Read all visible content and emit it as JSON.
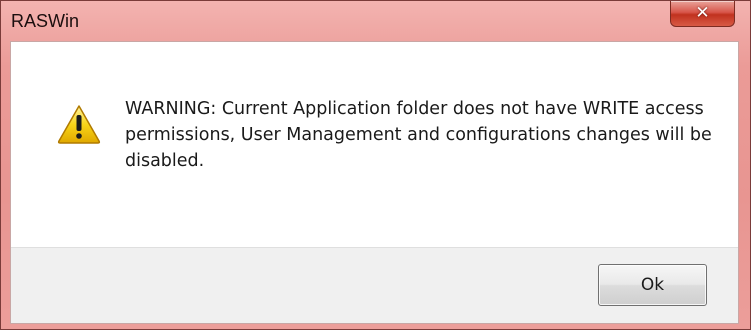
{
  "window": {
    "title": "RASWin",
    "close_icon": "close-icon"
  },
  "dialog": {
    "icon": "warning-icon",
    "message": "WARNING: Current Application folder does not have WRITE access permissions, User Management and configurations changes will be disabled.",
    "ok_label": "Ok"
  },
  "colors": {
    "titlebar": "#eb9b97",
    "close_button": "#c1321f",
    "warning_yellow": "#f5c400"
  }
}
